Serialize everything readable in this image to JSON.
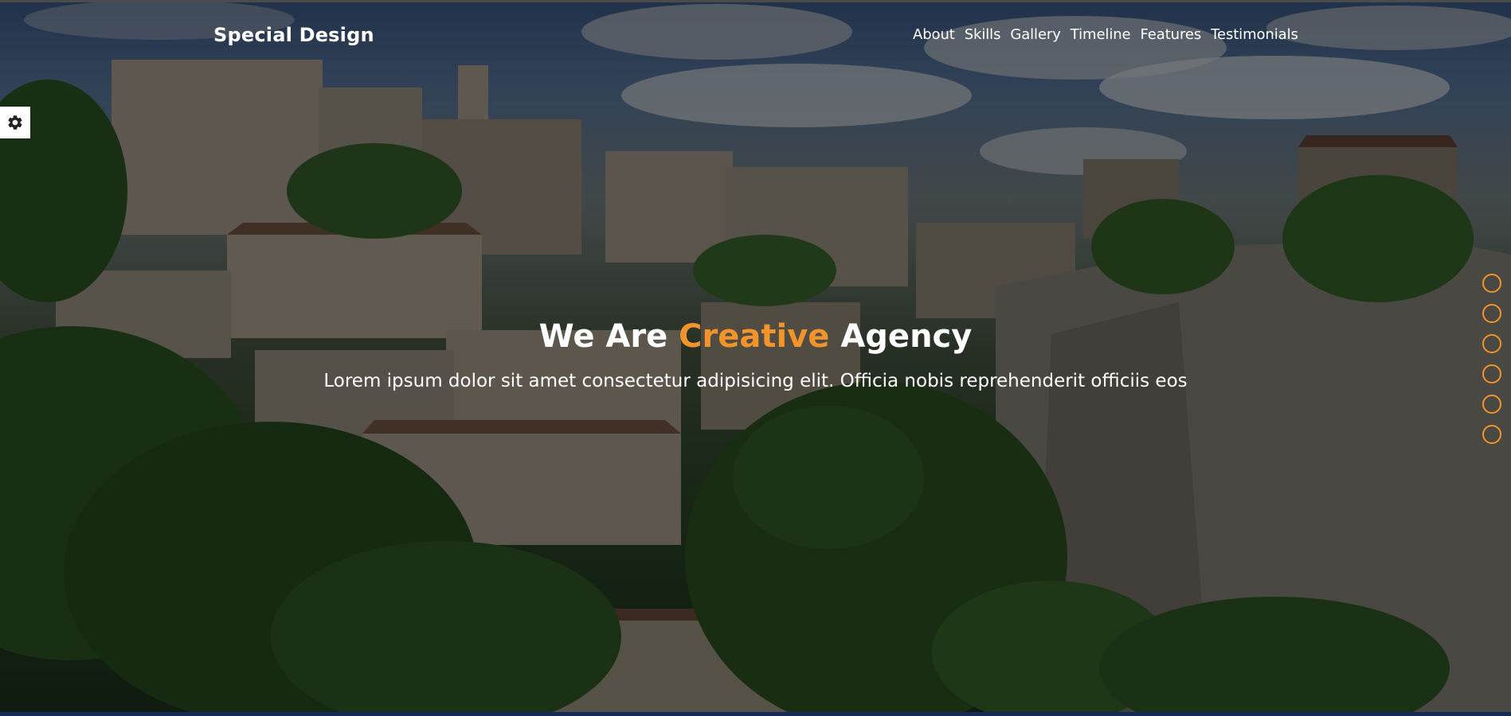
{
  "header": {
    "logo": "Special Design",
    "nav": [
      "About",
      "Skills",
      "Gallery",
      "Timeline",
      "Features",
      "Testimonials"
    ]
  },
  "settings": {
    "icon": "gear-icon"
  },
  "hero": {
    "headline_prefix": "We Are",
    "headline_accent": "Creative",
    "headline_suffix": "Agency",
    "subtitle": "Lorem ipsum dolor sit amet consectetur adipisicing elit. Officia nobis reprehenderit officiis eos"
  },
  "bullets": {
    "count": 6,
    "color": "#f0942b"
  },
  "colors": {
    "accent": "#f0942b",
    "text": "#ffffff"
  }
}
